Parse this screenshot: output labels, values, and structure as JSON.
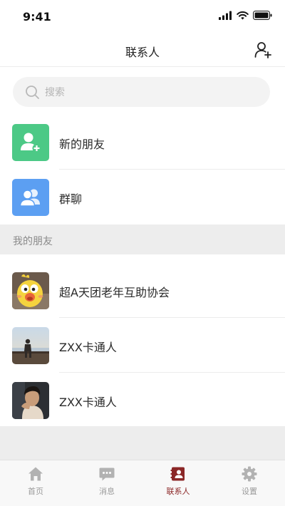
{
  "status": {
    "time": "9:41"
  },
  "nav": {
    "title": "联系人"
  },
  "search": {
    "placeholder": "搜索"
  },
  "entries": [
    {
      "label": "新的朋友",
      "icon": "add-friend-icon",
      "color": "#4cc986"
    },
    {
      "label": "群聊",
      "icon": "group-chat-icon",
      "color": "#5c9ff2"
    }
  ],
  "section": {
    "title": "我的朋友"
  },
  "friends": [
    {
      "name": "超A天团老年互助协会",
      "avatar": "yellow-bird-avatar"
    },
    {
      "name": "ZXX卡通人",
      "avatar": "seaside-person-avatar"
    },
    {
      "name": "ZXX卡通人",
      "avatar": "portrait-avatar"
    }
  ],
  "tabs": [
    {
      "label": "首页",
      "icon": "home-icon",
      "active": false
    },
    {
      "label": "消息",
      "icon": "message-icon",
      "active": false
    },
    {
      "label": "联系人",
      "icon": "contacts-icon",
      "active": true
    },
    {
      "label": "设置",
      "icon": "settings-icon",
      "active": false
    }
  ],
  "colors": {
    "accent": "#8b2727",
    "inactive": "#b2b2b2",
    "green": "#4cc986",
    "blue": "#5c9ff2"
  }
}
